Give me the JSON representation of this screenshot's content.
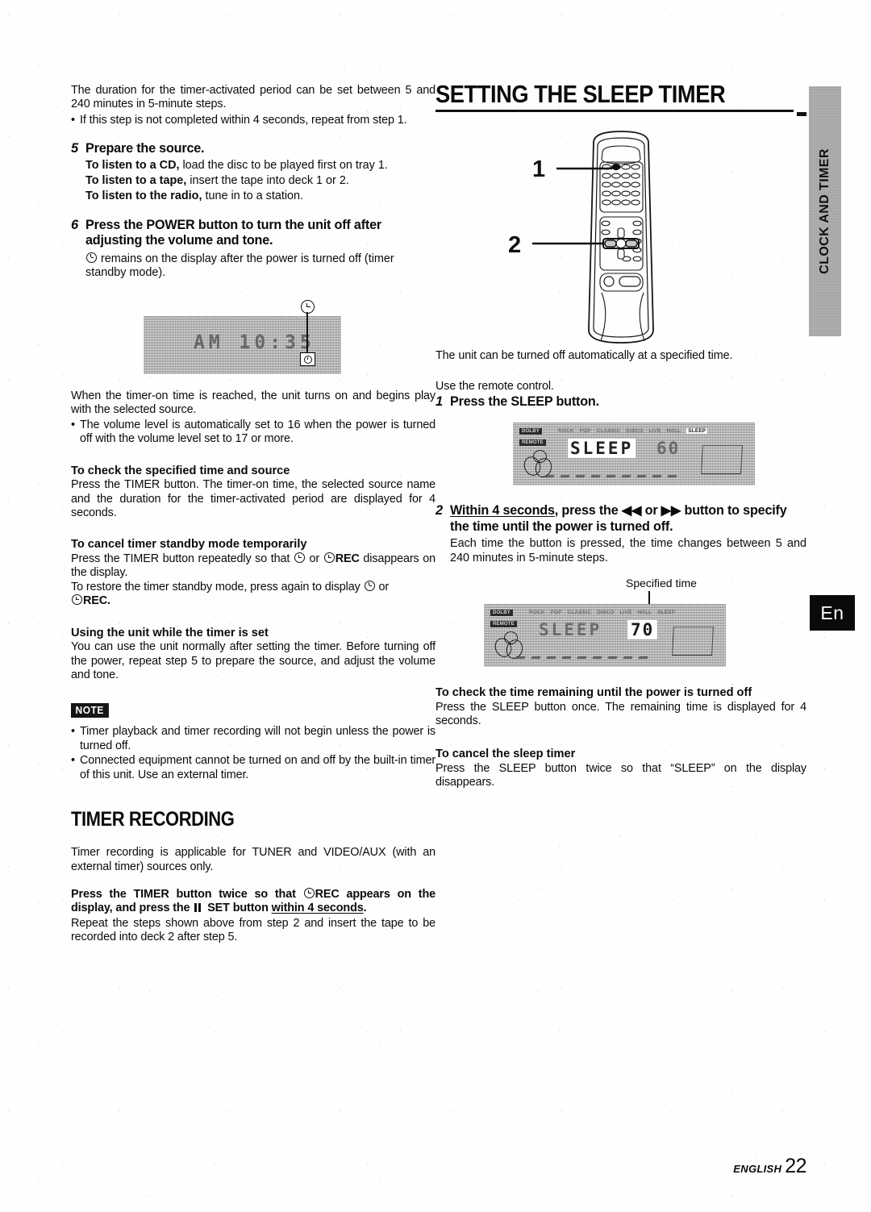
{
  "left_column": {
    "intro": {
      "p1": "The duration for the timer-activated period can be set between 5 and 240 minutes in 5-minute steps.",
      "bullet1": "If this step is not completed within 4 seconds, repeat from step 1."
    },
    "step5": {
      "num": "5",
      "heading": "Prepare the source.",
      "line_cd_bold": "To listen to a CD,",
      "line_cd_rest": " load the disc to be played first on tray 1.",
      "line_tape_bold": "To listen to a tape,",
      "line_tape_rest": " insert the tape into deck 1 or 2.",
      "line_radio_bold": "To listen to the radio,",
      "line_radio_rest": " tune in to a station."
    },
    "step6": {
      "num": "6",
      "heading": "Press the POWER button to turn the unit off after adjusting the volume and tone.",
      "sub_after_icon": " remains on the display after the power is turned off (timer standby mode)."
    },
    "lcd_clock": {
      "segment_text": "AM 10:35",
      "callout_icon": "clock-icon"
    },
    "after_lcd": {
      "p1": "When the timer-on time is reached, the unit turns on and begins play with the selected source.",
      "bullet1": "The volume level is automatically set to 16 when the power is turned off with the volume level set to 17 or more."
    },
    "check_time": {
      "heading": "To check the specified time and source",
      "body": "Press the TIMER button. The timer-on time, the selected source name and the duration for the timer-activated period are displayed for 4 seconds."
    },
    "cancel_standby": {
      "heading": "To cancel timer standby mode temporarily",
      "body_a": "Press the TIMER button repeatedly so that ",
      "body_b": " or ",
      "rec_label": "REC",
      "body_c": " disappears on the display.",
      "body_d": "To restore the timer standby mode, press again to display ",
      "body_e": " or ",
      "body_f": "."
    },
    "using_unit": {
      "heading": "Using the unit while the timer is set",
      "body": "You can use the unit normally after setting the timer. Before turning off the power, repeat step 5 to prepare the source, and adjust the volume and tone."
    },
    "note": {
      "badge": "NOTE",
      "bullet1": "Timer playback and timer recording will not begin unless the power is turned off.",
      "bullet2": "Connected equipment cannot be turned on and off by the built-in timer of this unit.  Use an external timer."
    },
    "timer_recording": {
      "heading": "TIMER RECORDING",
      "body1": "Timer recording is applicable for TUNER and VIDEO/AUX (with an external timer) sources only.",
      "bold_a": "Press the TIMER button twice so that ",
      "bold_rec": "REC",
      "bold_b": " appears on the display, and press the ",
      "bold_set": " SET button ",
      "bold_underline": "within 4 seconds",
      "bold_c": ".",
      "body2": "Repeat the steps shown above from step 2 and insert the tape to be recorded into deck 2 after step 5."
    }
  },
  "right_column": {
    "title": "SETTING THE SLEEP TIMER",
    "remote": {
      "callout_1": "1",
      "callout_2": "2"
    },
    "intro": "The unit can be turned off automatically at a specified time.",
    "use_remote": "Use the remote control.",
    "step1": {
      "num": "1",
      "heading": "Press the SLEEP button."
    },
    "lcd1": {
      "indicators": [
        "ROCK",
        "POP",
        "CLASSIC",
        "DISCO",
        "LIVE",
        "HALL",
        "SLEEP"
      ],
      "active_indicator": "SLEEP",
      "word": "SLEEP",
      "word_highlighted": true,
      "number": "60",
      "number_highlighted": false,
      "badge_top": "DOLBY",
      "badge_bottom": "REMOTE"
    },
    "step2": {
      "num": "2",
      "heading_underline": "Within 4 seconds",
      "heading_a": ", press the ",
      "heading_rew": "◀◀",
      "heading_b": " or ",
      "heading_ff": "▶▶",
      "heading_c": " button to specify the time until the power is turned off.",
      "sub": "Each time the button is pressed, the time changes between 5 and 240 minutes in 5-minute steps."
    },
    "lcd2": {
      "callout_label": "Specified time",
      "indicators": [
        "ROCK",
        "POP",
        "CLASSIC",
        "DISCO",
        "LIVE",
        "HALL",
        "SLEEP"
      ],
      "active_indicator": "",
      "word": "SLEEP",
      "word_highlighted": false,
      "number": "70",
      "number_highlighted": true,
      "badge_top": "DOLBY",
      "badge_bottom": "REMOTE"
    },
    "check_remaining": {
      "heading": "To check the time remaining until the power is turned off",
      "body": "Press the SLEEP button once.  The remaining time is displayed for 4 seconds."
    },
    "cancel_sleep": {
      "heading": "To cancel the sleep timer",
      "body": "Press the SLEEP button twice so that “SLEEP” on the display disappears."
    }
  },
  "side_tab": {
    "label": "CLOCK AND TIMER"
  },
  "lang_badge": {
    "label": "En"
  },
  "footer": {
    "english": "ENGLISH",
    "page": "22"
  }
}
